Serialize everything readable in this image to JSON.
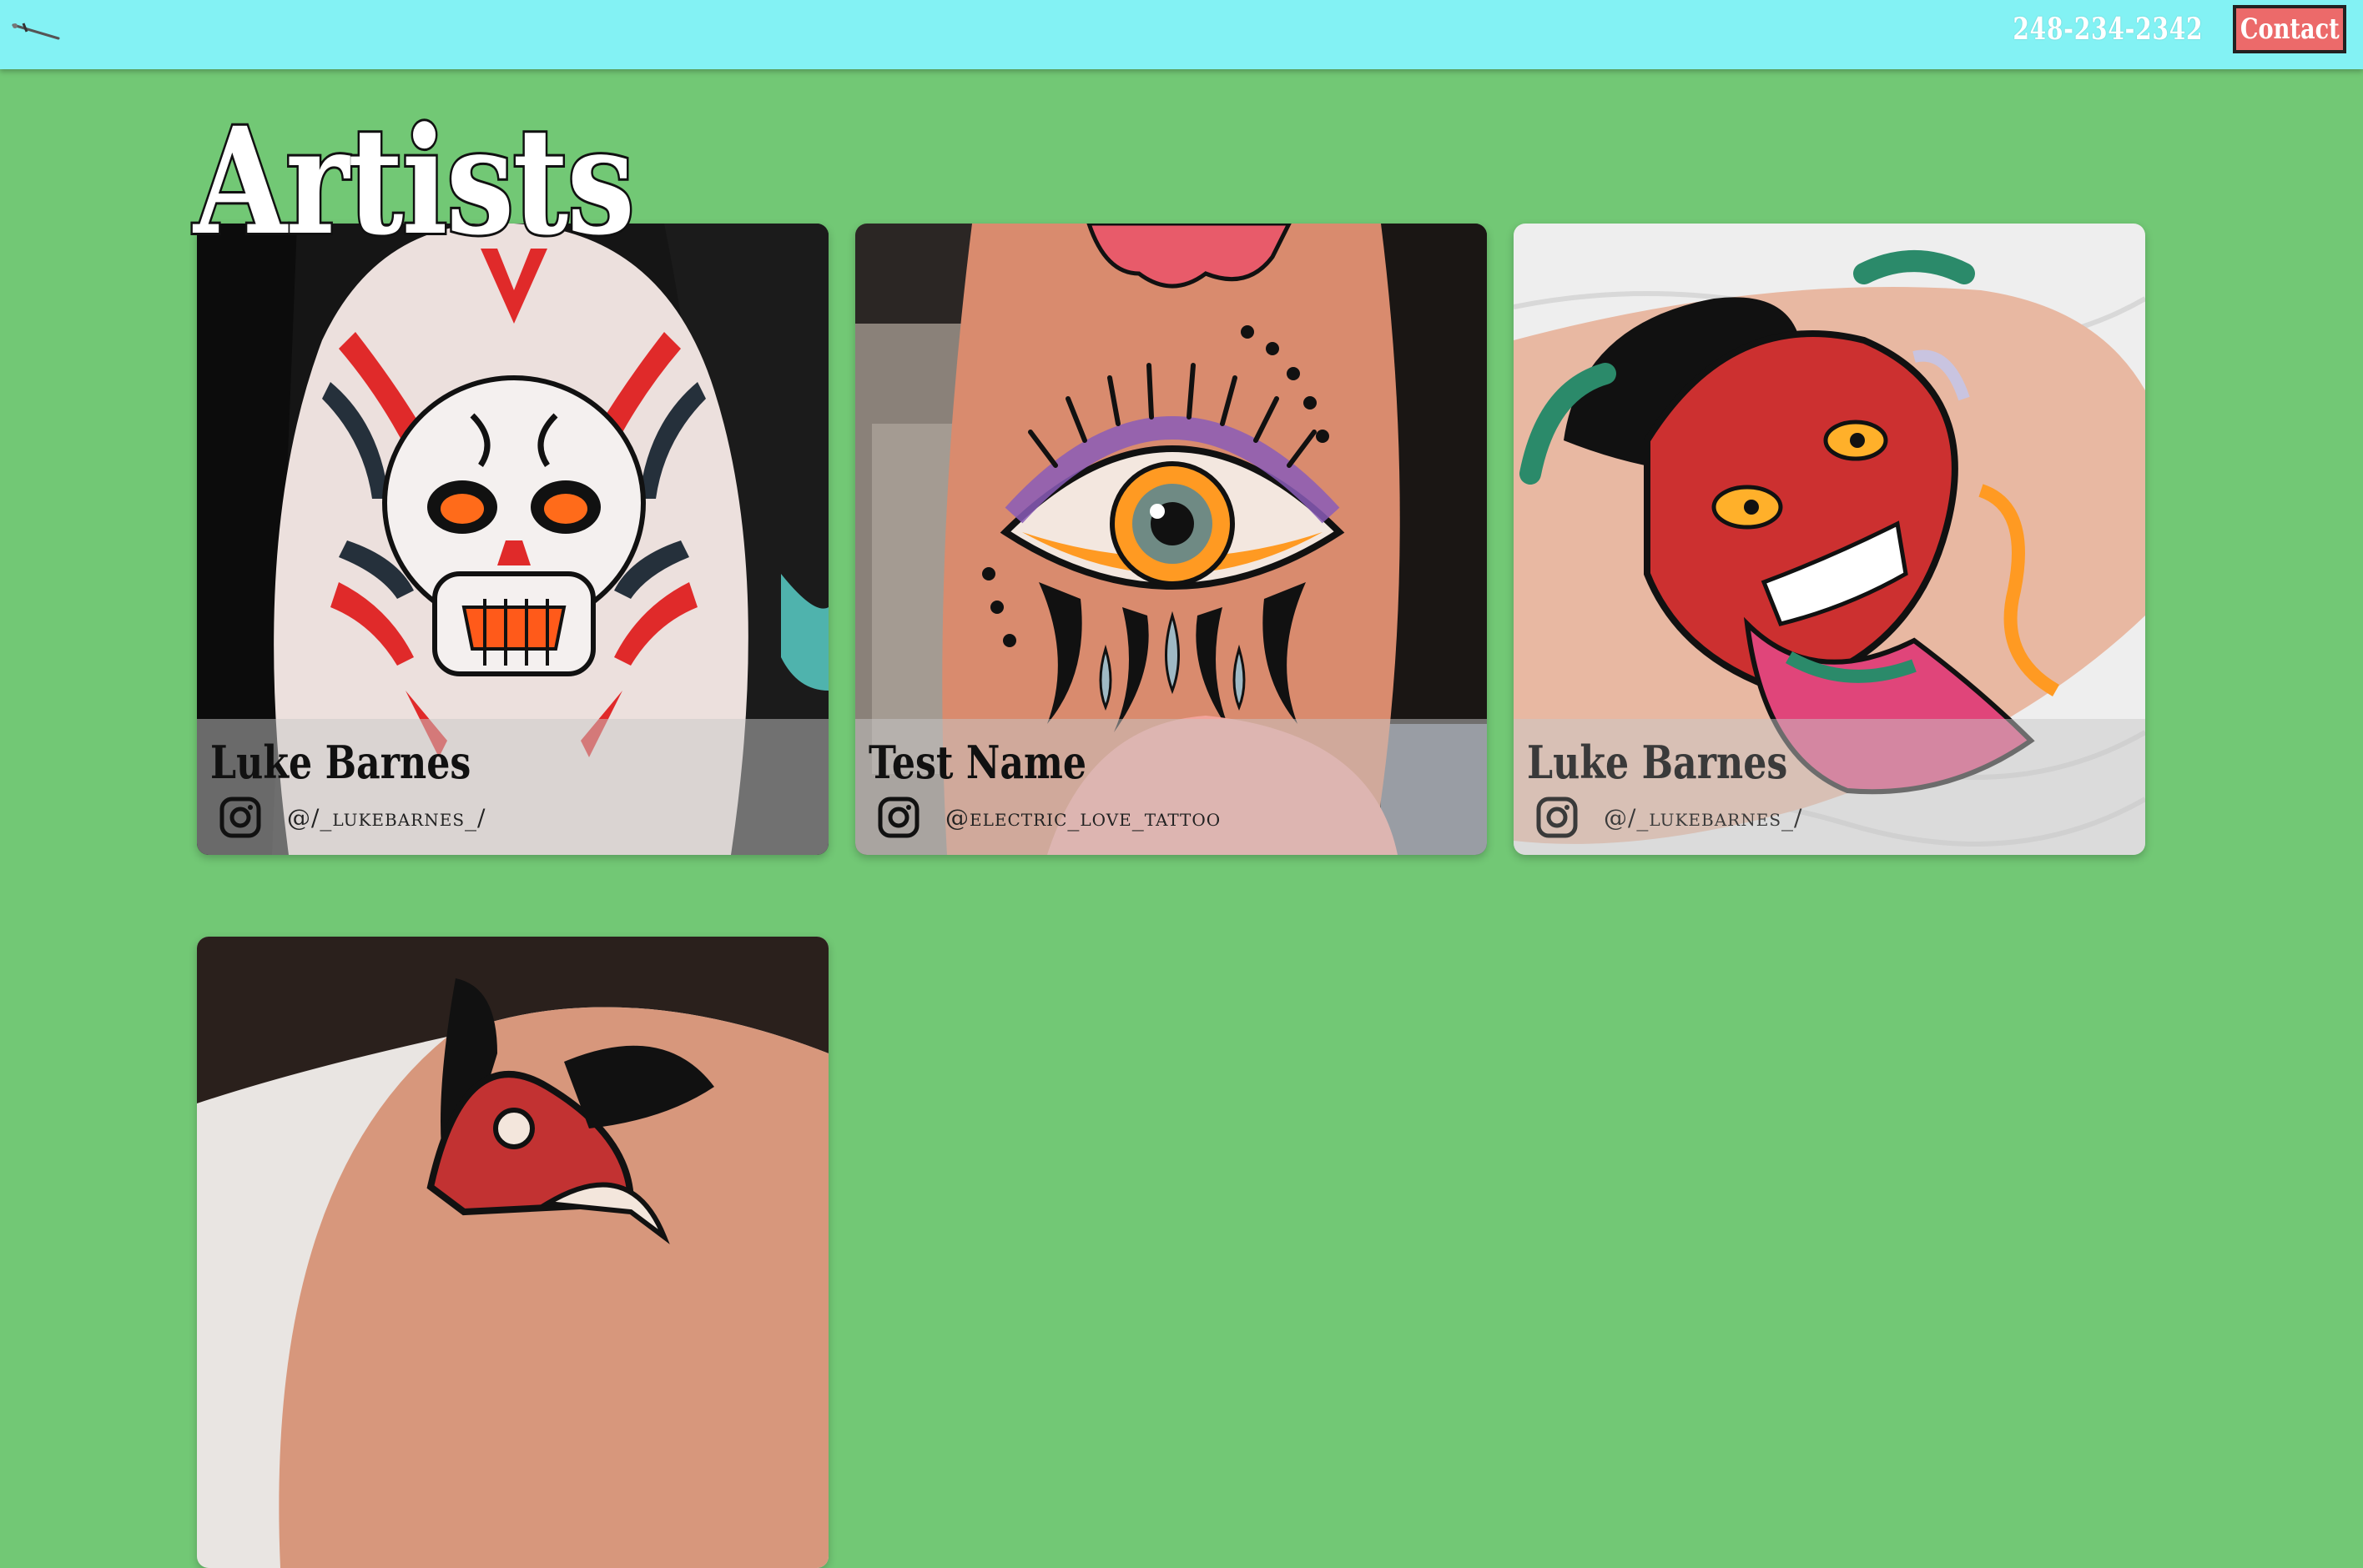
{
  "header": {
    "phone": "248-234-2342",
    "contact_label": "Contact"
  },
  "page": {
    "title": "Artists"
  },
  "artists": [
    {
      "name": "Luke Barnes",
      "handle": "@/_lukebarnes_/",
      "icon": "instagram-icon",
      "artwork": "skull-tattoo"
    },
    {
      "name": "Test Name",
      "handle": "@electric_love_tattoo",
      "icon": "instagram-icon",
      "artwork": "eye-tattoo"
    },
    {
      "name": "Luke Barnes",
      "handle": "@/_lukebarnes_/",
      "icon": "instagram-icon",
      "artwork": "demon-mask-tattoo"
    },
    {
      "artwork": "traditional-tattoo"
    }
  ],
  "colors": {
    "header_bg": "#83f2f4",
    "page_bg": "#72c875",
    "contact_bg": "#ec6a6a",
    "title_fill": "#ffffff"
  }
}
